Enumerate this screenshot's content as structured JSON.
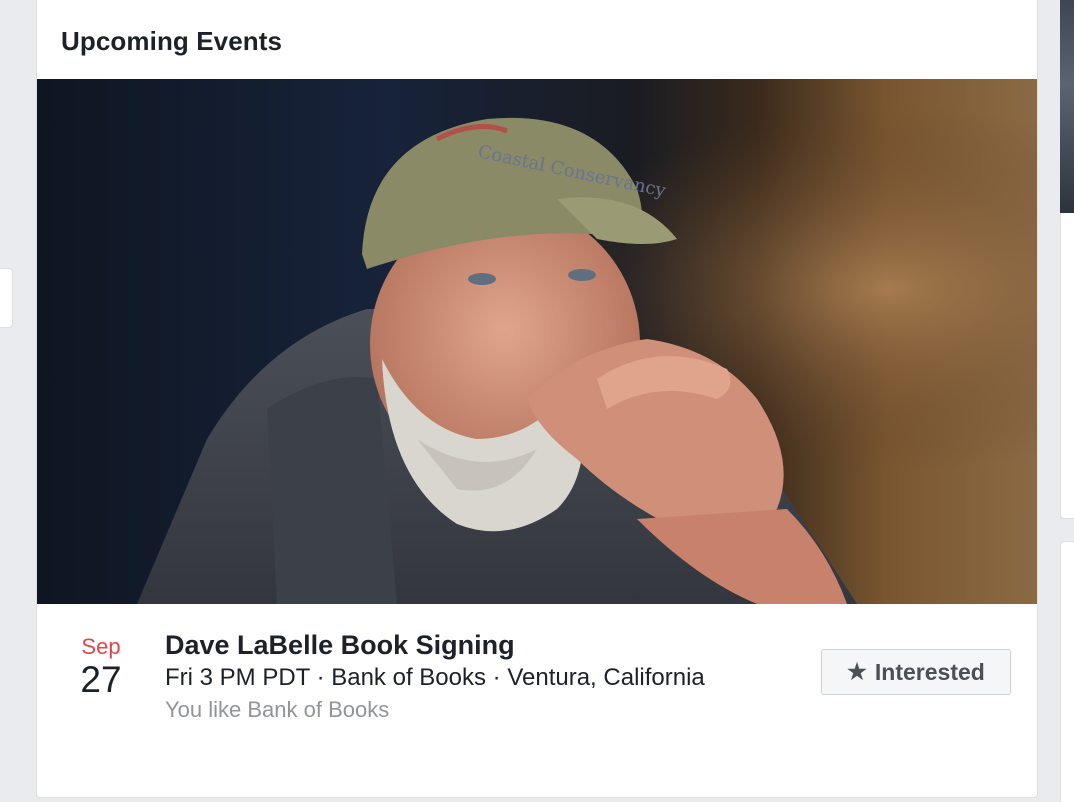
{
  "card": {
    "title": "Upcoming Events"
  },
  "event": {
    "date_month": "Sep",
    "date_day": "27",
    "title": "Dave LaBelle Book Signing",
    "meta": "Fri 3 PM PDT · Bank of Books · Ventura, California",
    "social": "You like Bank of Books",
    "interested_label": "Interested",
    "interested_icon": "star-icon"
  },
  "colors": {
    "month_red": "#e0474d",
    "text_dark": "#1d2129",
    "text_muted": "#90949c",
    "button_bg": "#f5f6f7",
    "page_bg": "#e9ebee"
  }
}
